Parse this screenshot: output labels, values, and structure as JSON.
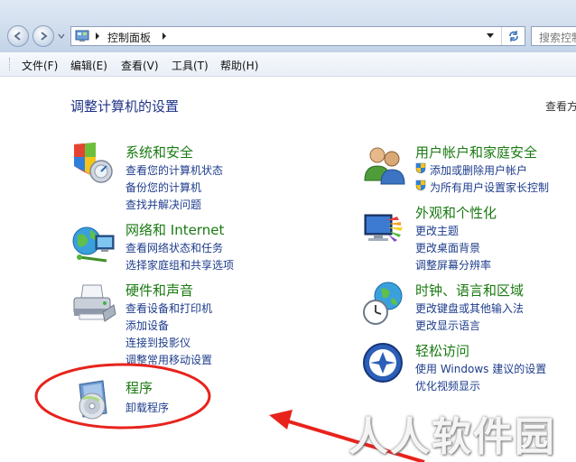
{
  "toolbar": {
    "address_crumb": "控制面板",
    "search_placeholder": "搜索控制"
  },
  "menu": [
    "文件(F)",
    "编辑(E)",
    "查看(V)",
    "工具(T)",
    "帮助(H)"
  ],
  "main": {
    "heading": "调整计算机的设置",
    "view_by": "查看方式"
  },
  "categories": {
    "system_security": {
      "title": "系统和安全",
      "links": [
        "查看您的计算机状态",
        "备份您的计算机",
        "查找并解决问题"
      ]
    },
    "network": {
      "title": "网络和 Internet",
      "links": [
        "查看网络状态和任务",
        "选择家庭组和共享选项"
      ]
    },
    "hardware": {
      "title": "硬件和声音",
      "links": [
        "查看设备和打印机",
        "添加设备",
        "连接到投影仪",
        "调整常用移动设置"
      ]
    },
    "programs": {
      "title": "程序",
      "links": [
        "卸载程序"
      ]
    },
    "user_accounts": {
      "title": "用户帐户和家庭安全",
      "links": [
        "添加或删除用户帐户",
        "为所有用户设置家长控制"
      ]
    },
    "appearance": {
      "title": "外观和个性化",
      "links": [
        "更改主题",
        "更改桌面背景",
        "调整屏幕分辨率"
      ]
    },
    "clock": {
      "title": "时钟、语言和区域",
      "links": [
        "更改键盘或其他输入法",
        "更改显示语言"
      ]
    },
    "ease": {
      "title": "轻松访问",
      "links": [
        "使用 Windows 建议的设置",
        "优化视频显示"
      ]
    }
  },
  "watermark": "人人软件园",
  "colors": {
    "category_title": "#1a7a12",
    "link": "#1e3c8c",
    "heading": "#1e3287",
    "annotation": "#e8231c"
  }
}
